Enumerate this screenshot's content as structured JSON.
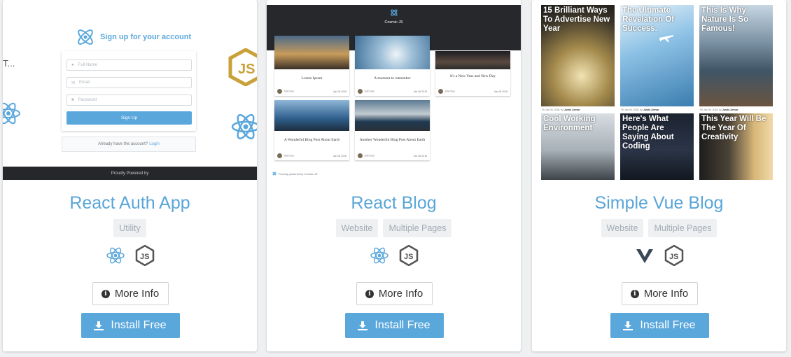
{
  "cards": [
    {
      "title": "React Auth App",
      "tags": [
        "Utility"
      ],
      "more_info": "More Info",
      "install": "Install Free",
      "preview": {
        "heading": "Sign up for your account",
        "fields": [
          "Full Name",
          "Email",
          "Password"
        ],
        "submit": "Sign Up",
        "already_text": "Already have the account?",
        "login_link": "Login",
        "footer": "Proudly Powered by",
        "side_text": "T..."
      }
    },
    {
      "title": "React Blog",
      "tags": [
        "Website",
        "Multiple Pages"
      ],
      "more_info": "More Info",
      "install": "Install Free",
      "preview": {
        "brand": "Cosmic JS",
        "posts": [
          {
            "title": "Lorem Ipsum",
            "author": "John Doe",
            "date": "Jan 08 2018"
          },
          {
            "title": "A moment to remember",
            "author": "John Doe",
            "date": "Jan 08 2018"
          },
          {
            "title": "It's a New Year and New Day",
            "author": "John Doe",
            "date": "Jan 08 2018"
          },
          {
            "title": "A Wonderful Blog Post About Earth",
            "author": "John Doe",
            "date": "Jan 08 2018"
          },
          {
            "title": "Another Wonderful Blog Post About Earth",
            "author": "John Doe",
            "date": "Jan 08 2018"
          }
        ],
        "footer": "Proudly powered by Cosmic JS"
      }
    },
    {
      "title": "Simple Vue Blog",
      "tags": [
        "Website",
        "Multiple Pages"
      ],
      "more_info": "More Info",
      "install": "Install Free",
      "preview": {
        "tiles": [
          {
            "title": "15 Brilliant Ways To Advertise New Year"
          },
          {
            "title": "The Ultimate Revelation Of Success."
          },
          {
            "title": "This Is Why Nature Is So Famous!"
          },
          {
            "title": "Cool Working Environment"
          },
          {
            "title": "Here's What People Are Saying About Coding"
          },
          {
            "title": "This Year Will Be The Year Of Creativity"
          }
        ],
        "date_line": "Fri Jan 05, 2018, by",
        "author": "Justin Zeevar"
      }
    }
  ],
  "colors": {
    "accent": "#59a5d8",
    "install_bg": "#5aa7dc",
    "tag_bg": "#eef0f2",
    "tag_text": "#a3acb5",
    "page_bg": "#eef0f2"
  },
  "icons": {
    "react": "react-icon",
    "node": "nodejs-icon",
    "vue": "vue-icon",
    "info": "info-circle-icon",
    "download": "download-icon"
  }
}
